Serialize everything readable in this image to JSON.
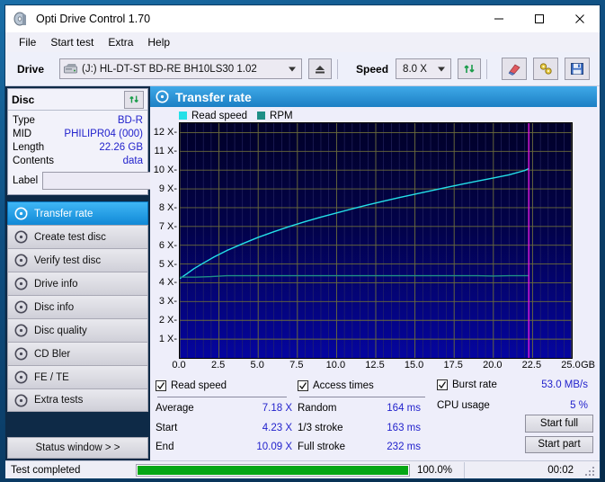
{
  "window": {
    "title": "Opti Drive Control 1.70",
    "app_icon": "disc-icon",
    "minimize": "—",
    "maximize": "☐",
    "close": "✕"
  },
  "menu": [
    "File",
    "Start test",
    "Extra",
    "Help"
  ],
  "toolbar": {
    "drive_label": "Drive",
    "drive_value": "(J:)  HL-DT-ST BD-RE  BH10LS30 1.02",
    "eject_icon": "eject-icon",
    "speed_label": "Speed",
    "speed_value": "8.0 X",
    "refresh_icon": "refresh-icon",
    "erase_icon": "eraser-icon",
    "tools_icon": "tools-icon",
    "save_icon": "save-icon"
  },
  "disc": {
    "header": "Disc",
    "refresh_icon": "refresh-icon",
    "rows": [
      {
        "key": "Type",
        "value": "BD-R"
      },
      {
        "key": "MID",
        "value": "PHILIPR04 (000)"
      },
      {
        "key": "Length",
        "value": "22.26 GB"
      },
      {
        "key": "Contents",
        "value": "data"
      }
    ],
    "label_key": "Label",
    "label_value": "",
    "label_placeholder": "",
    "label_button_icon": "cd-icon"
  },
  "sidebar": {
    "items": [
      {
        "label": "Transfer rate",
        "icon": "disc-icon",
        "active": true
      },
      {
        "label": "Create test disc",
        "icon": "disc-icon",
        "active": false
      },
      {
        "label": "Verify test disc",
        "icon": "disc-icon",
        "active": false
      },
      {
        "label": "Drive info",
        "icon": "disc-icon",
        "active": false
      },
      {
        "label": "Disc info",
        "icon": "disc-icon",
        "active": false
      },
      {
        "label": "Disc quality",
        "icon": "disc-icon",
        "active": false
      },
      {
        "label": "CD Bler",
        "icon": "disc-icon",
        "active": false
      },
      {
        "label": "FE / TE",
        "icon": "disc-icon",
        "active": false
      },
      {
        "label": "Extra tests",
        "icon": "disc-icon",
        "active": false
      }
    ],
    "status_window_button": "Status window > >"
  },
  "panel": {
    "title": "Transfer rate",
    "icon": "disc-icon"
  },
  "chart_data": {
    "type": "line",
    "title": "Transfer rate",
    "xlabel": "GB",
    "ylabel": "X",
    "xlim": [
      0.0,
      25.0
    ],
    "ylim": [
      0.0,
      12.5
    ],
    "xticks": [
      0.0,
      2.5,
      5.0,
      7.5,
      10.0,
      12.5,
      15.0,
      17.5,
      20.0,
      22.5,
      25.0
    ],
    "xticklabels": [
      "0.0",
      "2.5",
      "5.0",
      "7.5",
      "10.0",
      "12.5",
      "15.0",
      "17.5",
      "20.0",
      "22.5",
      "25.0"
    ],
    "yticks": [
      1,
      2,
      3,
      4,
      5,
      6,
      7,
      8,
      9,
      10,
      11,
      12
    ],
    "yticklabels": [
      "1 X",
      "2 X",
      "3 X",
      "4 X",
      "5 X",
      "6 X",
      "7 X",
      "8 X",
      "9 X",
      "10 X",
      "11 X",
      "12 X"
    ],
    "grid": true,
    "legend_position": "top-left",
    "legend": [
      {
        "name": "Read speed",
        "color": "#24e0e8"
      },
      {
        "name": "RPM",
        "color": "#1f8f86"
      }
    ],
    "end_marker_x": 22.26,
    "end_marker_color": "#e018e0",
    "series": [
      {
        "name": "Read speed",
        "color": "#24e0e8",
        "x": [
          0.0,
          0.4,
          0.9,
          1.5,
          2.2,
          3.0,
          4.0,
          5.0,
          6.0,
          7.0,
          8.0,
          9.0,
          10.0,
          11.0,
          12.0,
          13.0,
          14.0,
          15.0,
          16.0,
          17.0,
          18.0,
          19.0,
          20.0,
          21.0,
          22.0,
          22.26
        ],
        "y": [
          4.23,
          4.45,
          4.75,
          5.05,
          5.38,
          5.72,
          6.08,
          6.42,
          6.72,
          7.0,
          7.26,
          7.5,
          7.72,
          7.94,
          8.15,
          8.35,
          8.54,
          8.72,
          8.9,
          9.08,
          9.25,
          9.42,
          9.58,
          9.75,
          9.98,
          10.09
        ]
      },
      {
        "name": "RPM",
        "color": "#1f8f86",
        "x": [
          0.0,
          1.0,
          2.0,
          3.0,
          5.0,
          8.0,
          12.0,
          16.0,
          19.0,
          20.0,
          21.0,
          22.26
        ],
        "y": [
          4.3,
          4.3,
          4.33,
          4.38,
          4.38,
          4.38,
          4.38,
          4.38,
          4.38,
          4.36,
          4.38,
          4.38
        ]
      }
    ]
  },
  "stats": {
    "read_speed": {
      "checked": true,
      "label": "Read speed",
      "rows": [
        {
          "key": "Average",
          "value": "7.18 X"
        },
        {
          "key": "Start",
          "value": "4.23 X"
        },
        {
          "key": "End",
          "value": "10.09 X"
        }
      ]
    },
    "access_times": {
      "checked": true,
      "label": "Access times",
      "rows": [
        {
          "key": "Random",
          "value": "164 ms"
        },
        {
          "key": "1/3 stroke",
          "value": "163 ms"
        },
        {
          "key": "Full stroke",
          "value": "232 ms"
        }
      ]
    },
    "burst": {
      "checked": true,
      "label": "Burst rate",
      "value": "53.0 MB/s",
      "cpu_key": "CPU usage",
      "cpu_value": "5 %",
      "start_full": "Start full",
      "start_part": "Start part"
    }
  },
  "statusbar": {
    "text": "Test completed",
    "progress_percent": 100.0,
    "progress_label": "100.0%",
    "elapsed": "00:02"
  },
  "colors": {
    "accent": "#1c7fc4",
    "value_blue": "#2222cc",
    "progress_green": "#05a615",
    "read_speed": "#24e0e8",
    "rpm": "#1f8f86",
    "marker": "#e018e0"
  }
}
